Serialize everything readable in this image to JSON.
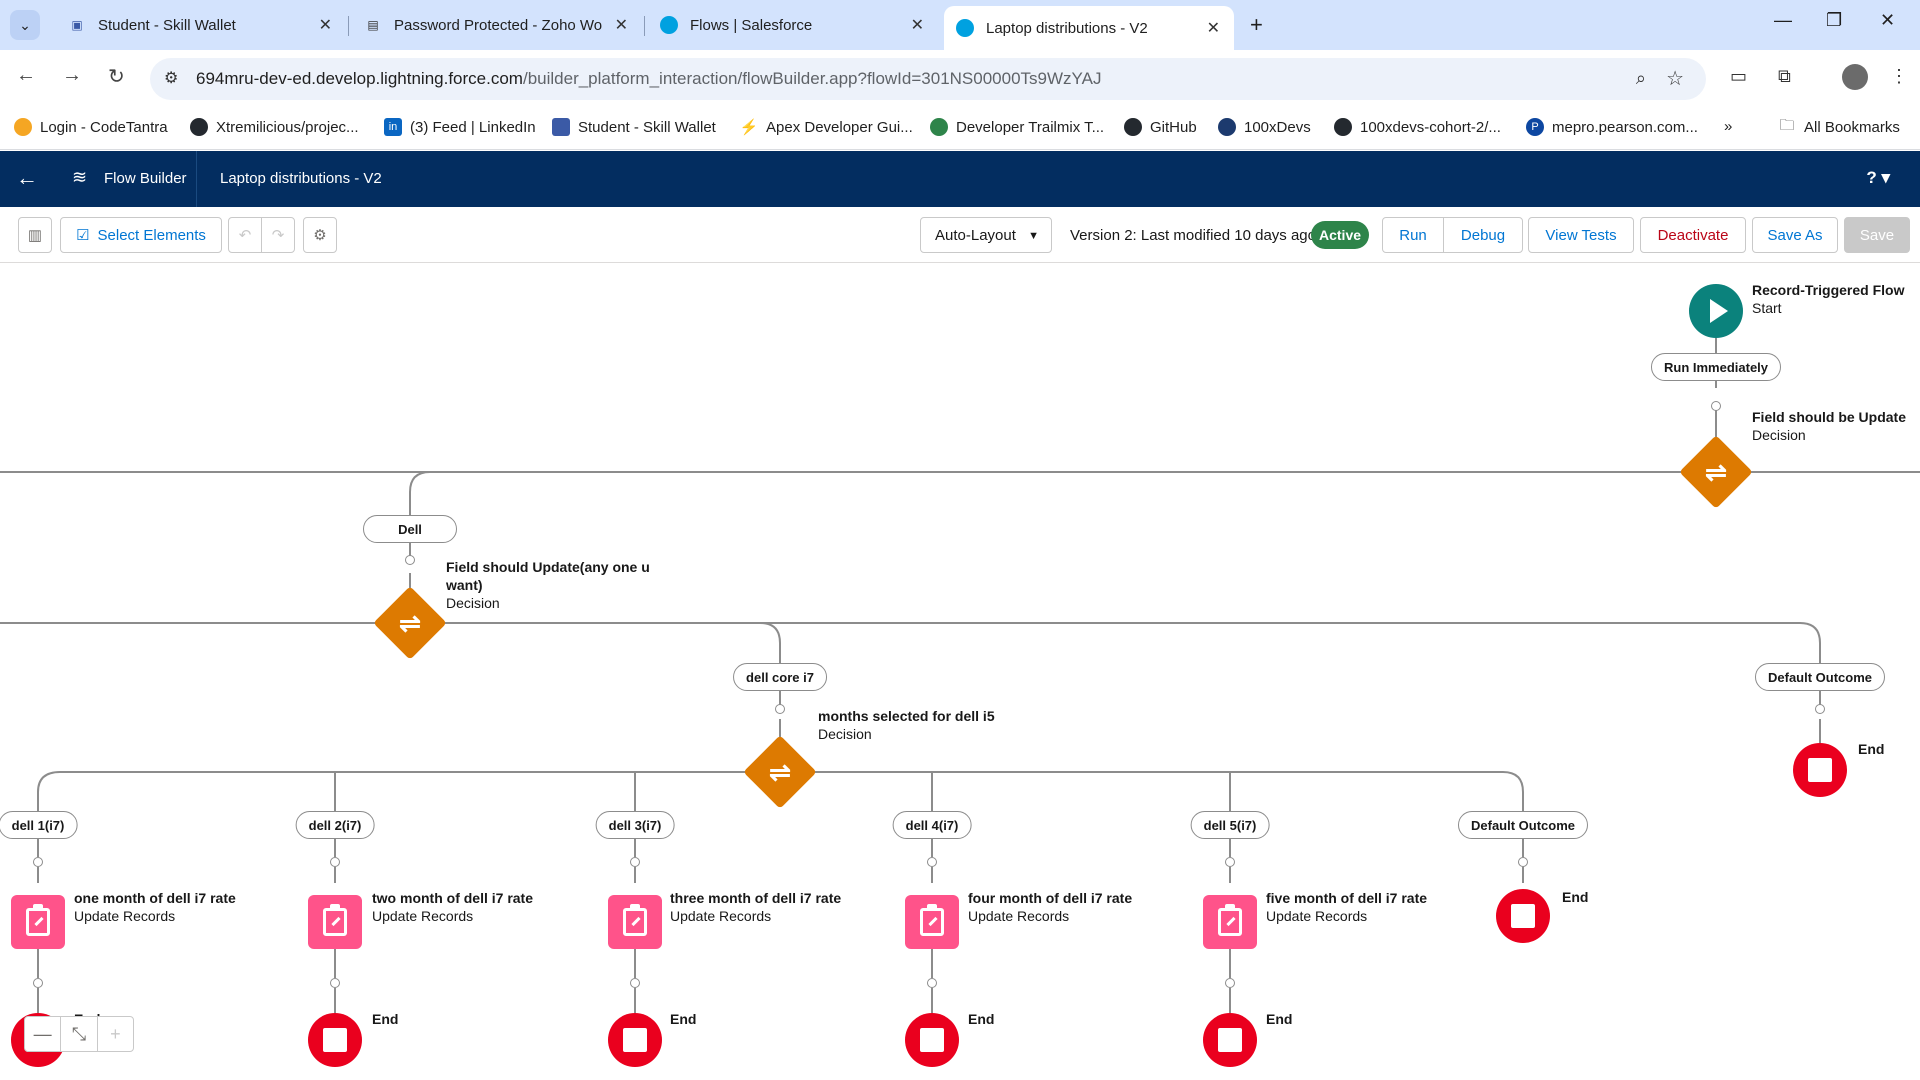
{
  "browser": {
    "tabs": [
      {
        "title": "Student - Skill Wallet",
        "icon": "skillwallet-icon"
      },
      {
        "title": "Password Protected - Zoho Wo",
        "icon": "zoho-icon"
      },
      {
        "title": "Flows | Salesforce",
        "icon": "salesforce-icon"
      },
      {
        "title": "Laptop distributions - V2",
        "icon": "salesforce-icon",
        "active": true
      }
    ],
    "url_host": "694mru-dev-ed.develop.lightning.force.com",
    "url_path": "/builder_platform_interaction/flowBuilder.app?flowId=301NS00000Ts9WzYAJ",
    "bookmarks": [
      "Login - CodeTantra",
      "Xtremilicious/projec...",
      "(3) Feed | LinkedIn",
      "Student - Skill Wallet",
      "Apex Developer Gui...",
      "Developer Trailmix T...",
      "GitHub",
      "100xDevs",
      "100xdevs-cohort-2/...",
      "mepro.pearson.com..."
    ],
    "more_bookmarks": "»",
    "all_bookmarks": "All Bookmarks"
  },
  "sf": {
    "app_name": "Flow Builder",
    "flow_name": "Laptop distributions - V2",
    "help": "? ▾"
  },
  "flowbar": {
    "select_elements": "Select Elements",
    "layout": "Auto-Layout",
    "version": "Version 2: Last modified 10 days ago",
    "status": "Active",
    "run": "Run",
    "debug": "Debug",
    "view_tests": "View Tests",
    "deactivate": "Deactivate",
    "save_as": "Save As",
    "save": "Save"
  },
  "canvas": {
    "start": {
      "title": "Record-Triggered Flow",
      "sub": "Start"
    },
    "run_immediately": "Run Immediately",
    "decision1": {
      "title": "Field should be Update",
      "sub": "Decision"
    },
    "dell": "Dell",
    "decision2": {
      "title": "Field should Update(any one u",
      "title2": "want)",
      "sub": "Decision"
    },
    "dell_core_i7": "dell core i7",
    "default_outcome": "Default Outcome",
    "decision3": {
      "title": "months selected for dell i5",
      "sub": "Decision"
    },
    "end": "End",
    "branches": [
      {
        "pill": "dell 1(i7)",
        "title": "one month of dell i7 rate",
        "sub": "Update Records"
      },
      {
        "pill": "dell 2(i7)",
        "title": "two month of dell i7 rate",
        "sub": "Update Records"
      },
      {
        "pill": "dell 3(i7)",
        "title": "three month of dell i7 rate",
        "sub": "Update Records"
      },
      {
        "pill": "dell 4(i7)",
        "title": "four month of dell i7 rate",
        "sub": "Update Records"
      },
      {
        "pill": "dell 5(i7)",
        "title": "five month of dell i7 rate",
        "sub": "Update Records"
      }
    ],
    "default_outcome2": "Default Outcome"
  },
  "colors": {
    "sf_header": "#032d60",
    "decision": "#dd7a01",
    "start": "#0b827c",
    "end": "#ea001e",
    "update": "#ff538a",
    "active_badge": "#2e844a"
  }
}
